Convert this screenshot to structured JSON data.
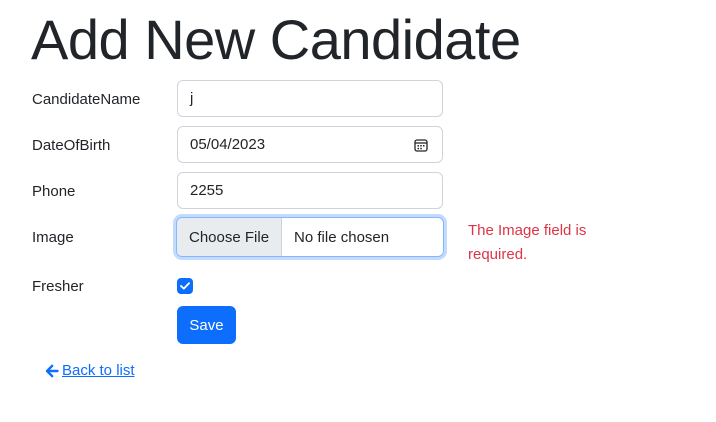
{
  "page": {
    "title": "Add New Candidate"
  },
  "form": {
    "candidate_name": {
      "label": "CandidateName",
      "value": "j"
    },
    "date_of_birth": {
      "label": "DateOfBirth",
      "value": "05/04/2023",
      "icon": "calendar-icon"
    },
    "phone": {
      "label": "Phone",
      "value": "2255"
    },
    "image": {
      "label": "Image",
      "button_label": "Choose File",
      "status": "No file chosen",
      "validation_message": "The Image field is required."
    },
    "fresher": {
      "label": "Fresher",
      "checked": true
    },
    "save_label": "Save"
  },
  "nav": {
    "back_label": " Back to list",
    "back_icon": "arrow-left-icon"
  },
  "colors": {
    "primary": "#0d6efd",
    "danger": "#dc3545",
    "text": "#212529"
  }
}
